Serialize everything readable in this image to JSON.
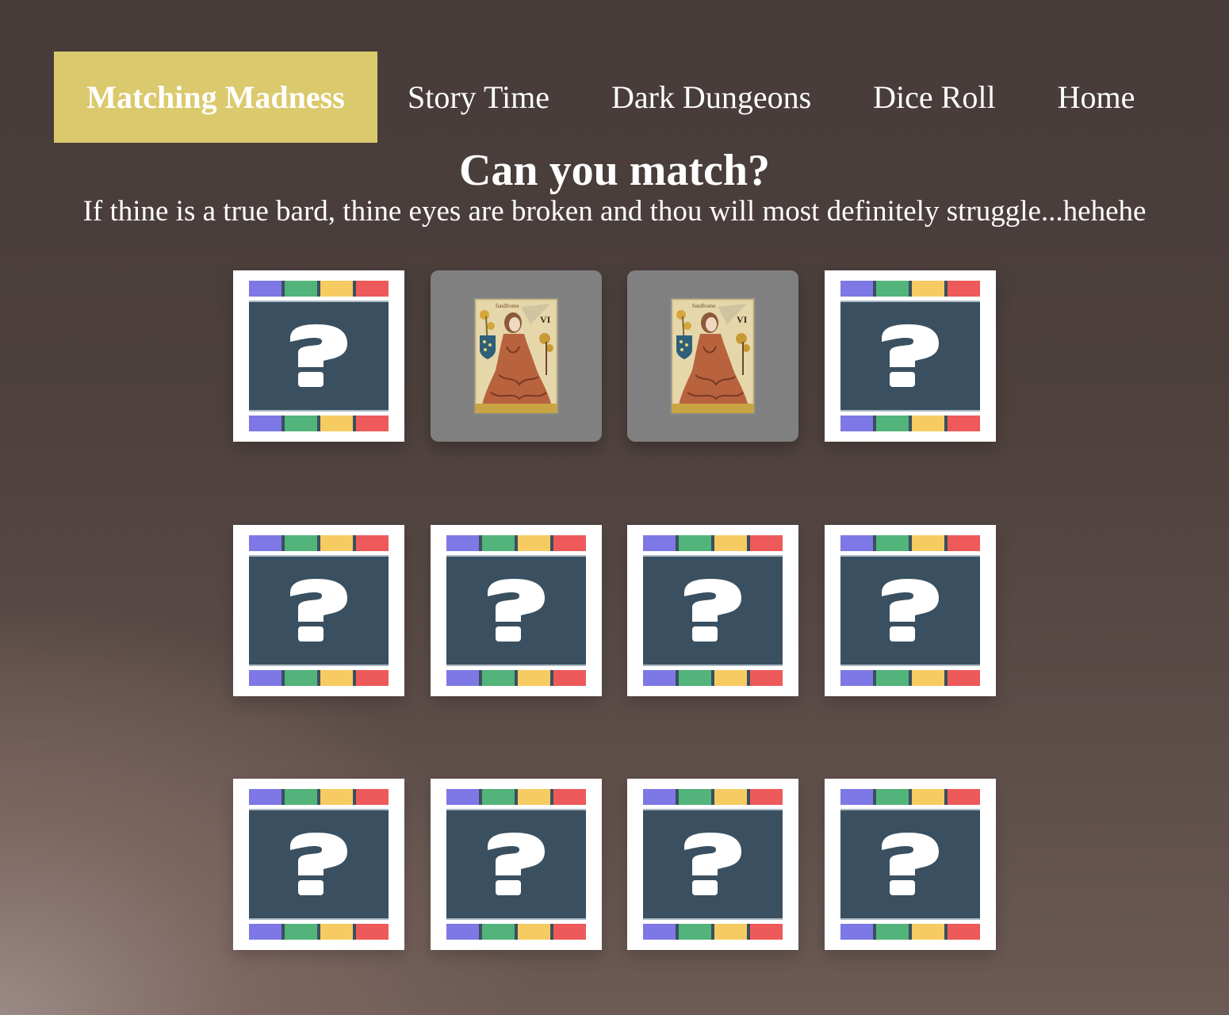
{
  "nav": {
    "items": [
      {
        "label": "Matching Madness",
        "active": true
      },
      {
        "label": "Story Time",
        "active": false
      },
      {
        "label": "Dark Dungeons",
        "active": false
      },
      {
        "label": "Dice Roll",
        "active": false
      },
      {
        "label": "Home",
        "active": false
      }
    ]
  },
  "header": {
    "title": "Can you match?",
    "subtitle": "If thine is a true bard, thine eyes are broken and thou will most definitely struggle...hehehe"
  },
  "cards": {
    "back_symbol": "question-mark-icon",
    "face_image": "tarot-queen-card-art",
    "face_image_label_top": "fundfrome",
    "face_image_label_numeral": "VI",
    "flipped_positions": [
      2,
      3
    ],
    "count": 12
  },
  "colors": {
    "accent": "#dbc96d",
    "card_back": "#3a5060",
    "stripe_purple": "#7d78e6",
    "stripe_green": "#52b47a",
    "stripe_yellow": "#f6cb62",
    "stripe_red": "#ee5a5a",
    "flipped_bg": "#808080"
  }
}
